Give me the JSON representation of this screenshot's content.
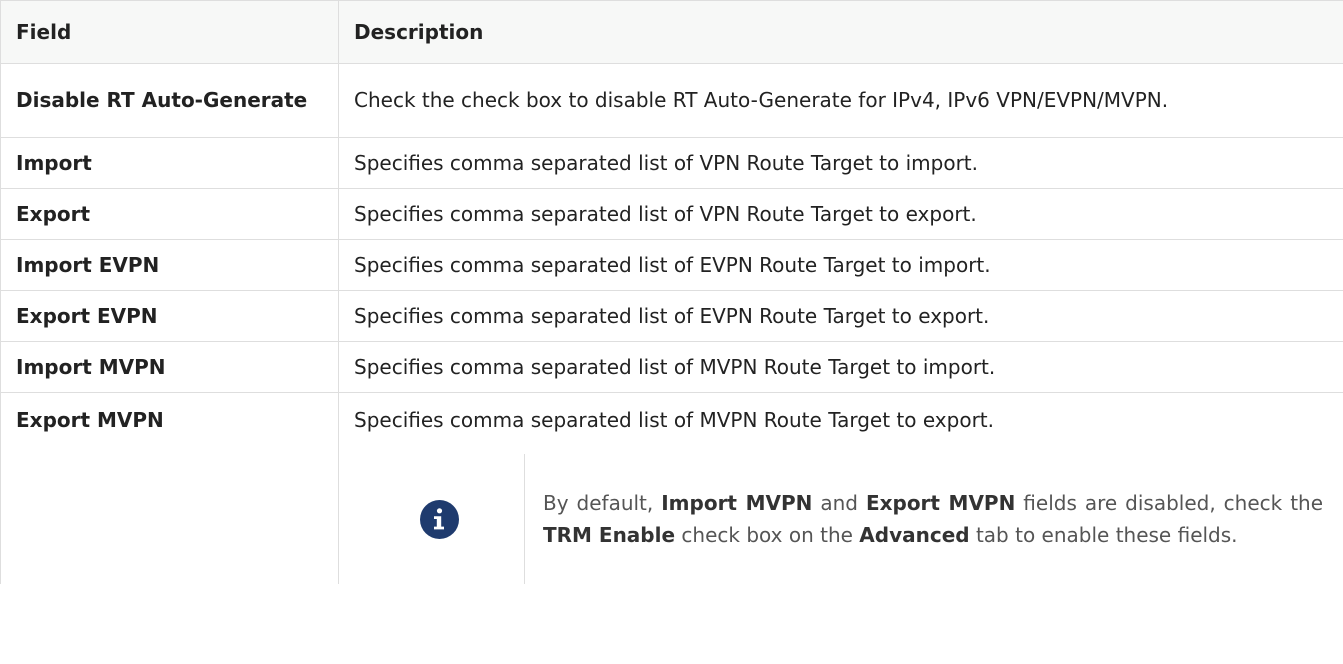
{
  "table": {
    "headers": {
      "field": "Field",
      "description": "Description"
    },
    "rows": [
      {
        "field": "Disable RT Auto-Generate",
        "description": "Check the check box to disable RT Auto-Generate for IPv4, IPv6 VPN/EVPN/MVPN."
      },
      {
        "field": "Import",
        "description": "Specifies comma separated list of VPN Route Target to import."
      },
      {
        "field": "Export",
        "description": "Specifies comma separated list of VPN Route Target to export."
      },
      {
        "field": "Import EVPN",
        "description": "Specifies comma separated list of EVPN Route Target to import."
      },
      {
        "field": "Export EVPN",
        "description": "Specifies comma separated list of EVPN Route Target to export."
      },
      {
        "field": "Import MVPN",
        "description": "Specifies comma separated list of MVPN Route Target to import."
      },
      {
        "field": "Export MVPN",
        "description": "Specifies comma separated list of MVPN Route Target to export."
      }
    ]
  },
  "note": {
    "icon": "info-icon",
    "text_1": "By default, ",
    "bold_1": "Import MVPN",
    "text_2": " and ",
    "bold_2": "Export MVPN",
    "text_3": " fields are disabled, check the ",
    "bold_3": "TRM Enable",
    "text_4": " check box on the ",
    "bold_4": "Advanced",
    "text_5": " tab to enable these fields."
  }
}
